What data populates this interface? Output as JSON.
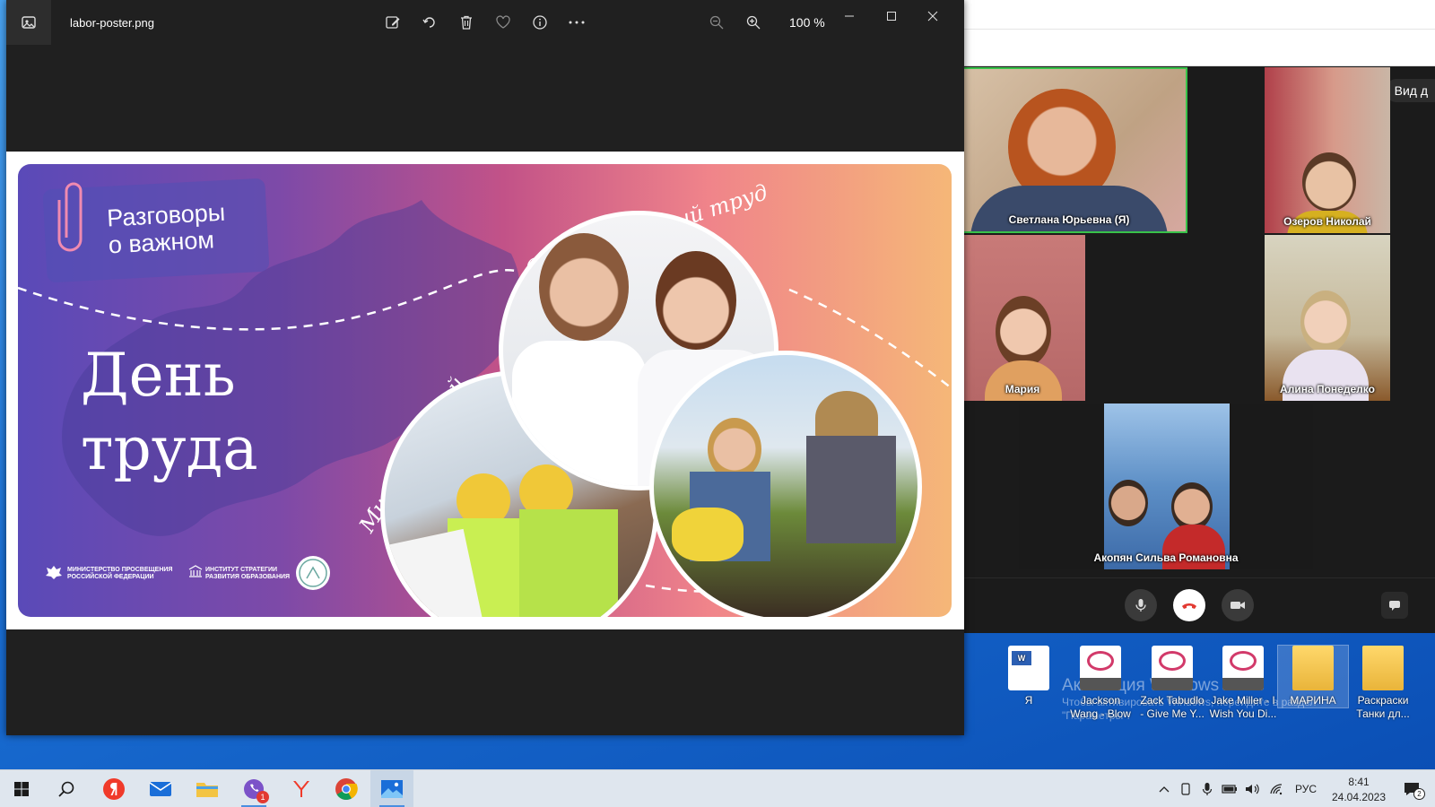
{
  "viewer": {
    "filename": "labor-poster.png",
    "zoom_level": "100 %"
  },
  "poster": {
    "badge": "Разговоры о важном",
    "badge_line1": "Разговоры",
    "badge_line2": "о важном",
    "title_line1": "День",
    "title_line2": "труда",
    "script_top": "Созидательный труд",
    "script_left": "Мир профессий",
    "logo1": "МИНИСТЕРСТВО ПРОСВЕЩЕНИЯ РОССИЙСКОЙ ФЕДЕРАЦИИ",
    "logo1_line1": "МИНИСТЕРСТВО ПРОСВЕЩЕНИЯ",
    "logo1_line2": "РОССИЙСКОЙ ФЕДЕРАЦИИ",
    "logo2": "ИНСТИТУТ СТРАТЕГИИ РАЗВИТИЯ ОБРАЗОВАНИЯ",
    "logo2_line1": "ИНСТИТУТ СТРАТЕГИИ",
    "logo2_line2": "РАЗВИТИЯ ОБРАЗОВАНИЯ"
  },
  "zoom": {
    "view_button": "Вид д",
    "participants": [
      {
        "name": "Светлана Юрьевна (Я)"
      },
      {
        "name": "Озеров Николай"
      },
      {
        "name": "Мария"
      },
      {
        "name": "Алина Понеделко"
      },
      {
        "name": "Акопян Сильва Романовна"
      }
    ]
  },
  "desktop": {
    "icons": [
      {
        "label": "Я"
      },
      {
        "label": "Jackson Wang - Blow"
      },
      {
        "label": "Zack Tabudlo - Give Me Y..."
      },
      {
        "label": "Jake Miller - I Wish You Di..."
      },
      {
        "label": "МАРИНА"
      },
      {
        "label": "Раскраски Танки дл..."
      }
    ],
    "activation_title": "Активация Windows",
    "activation_sub1": "Чтобы активировать Windows, перейдите в раздел",
    "activation_sub2": "\"Параметры\"."
  },
  "taskbar": {
    "language": "РУС",
    "time": "8:41",
    "date": "24.04.2023",
    "notification_count": "2",
    "viber_badge": "1"
  }
}
